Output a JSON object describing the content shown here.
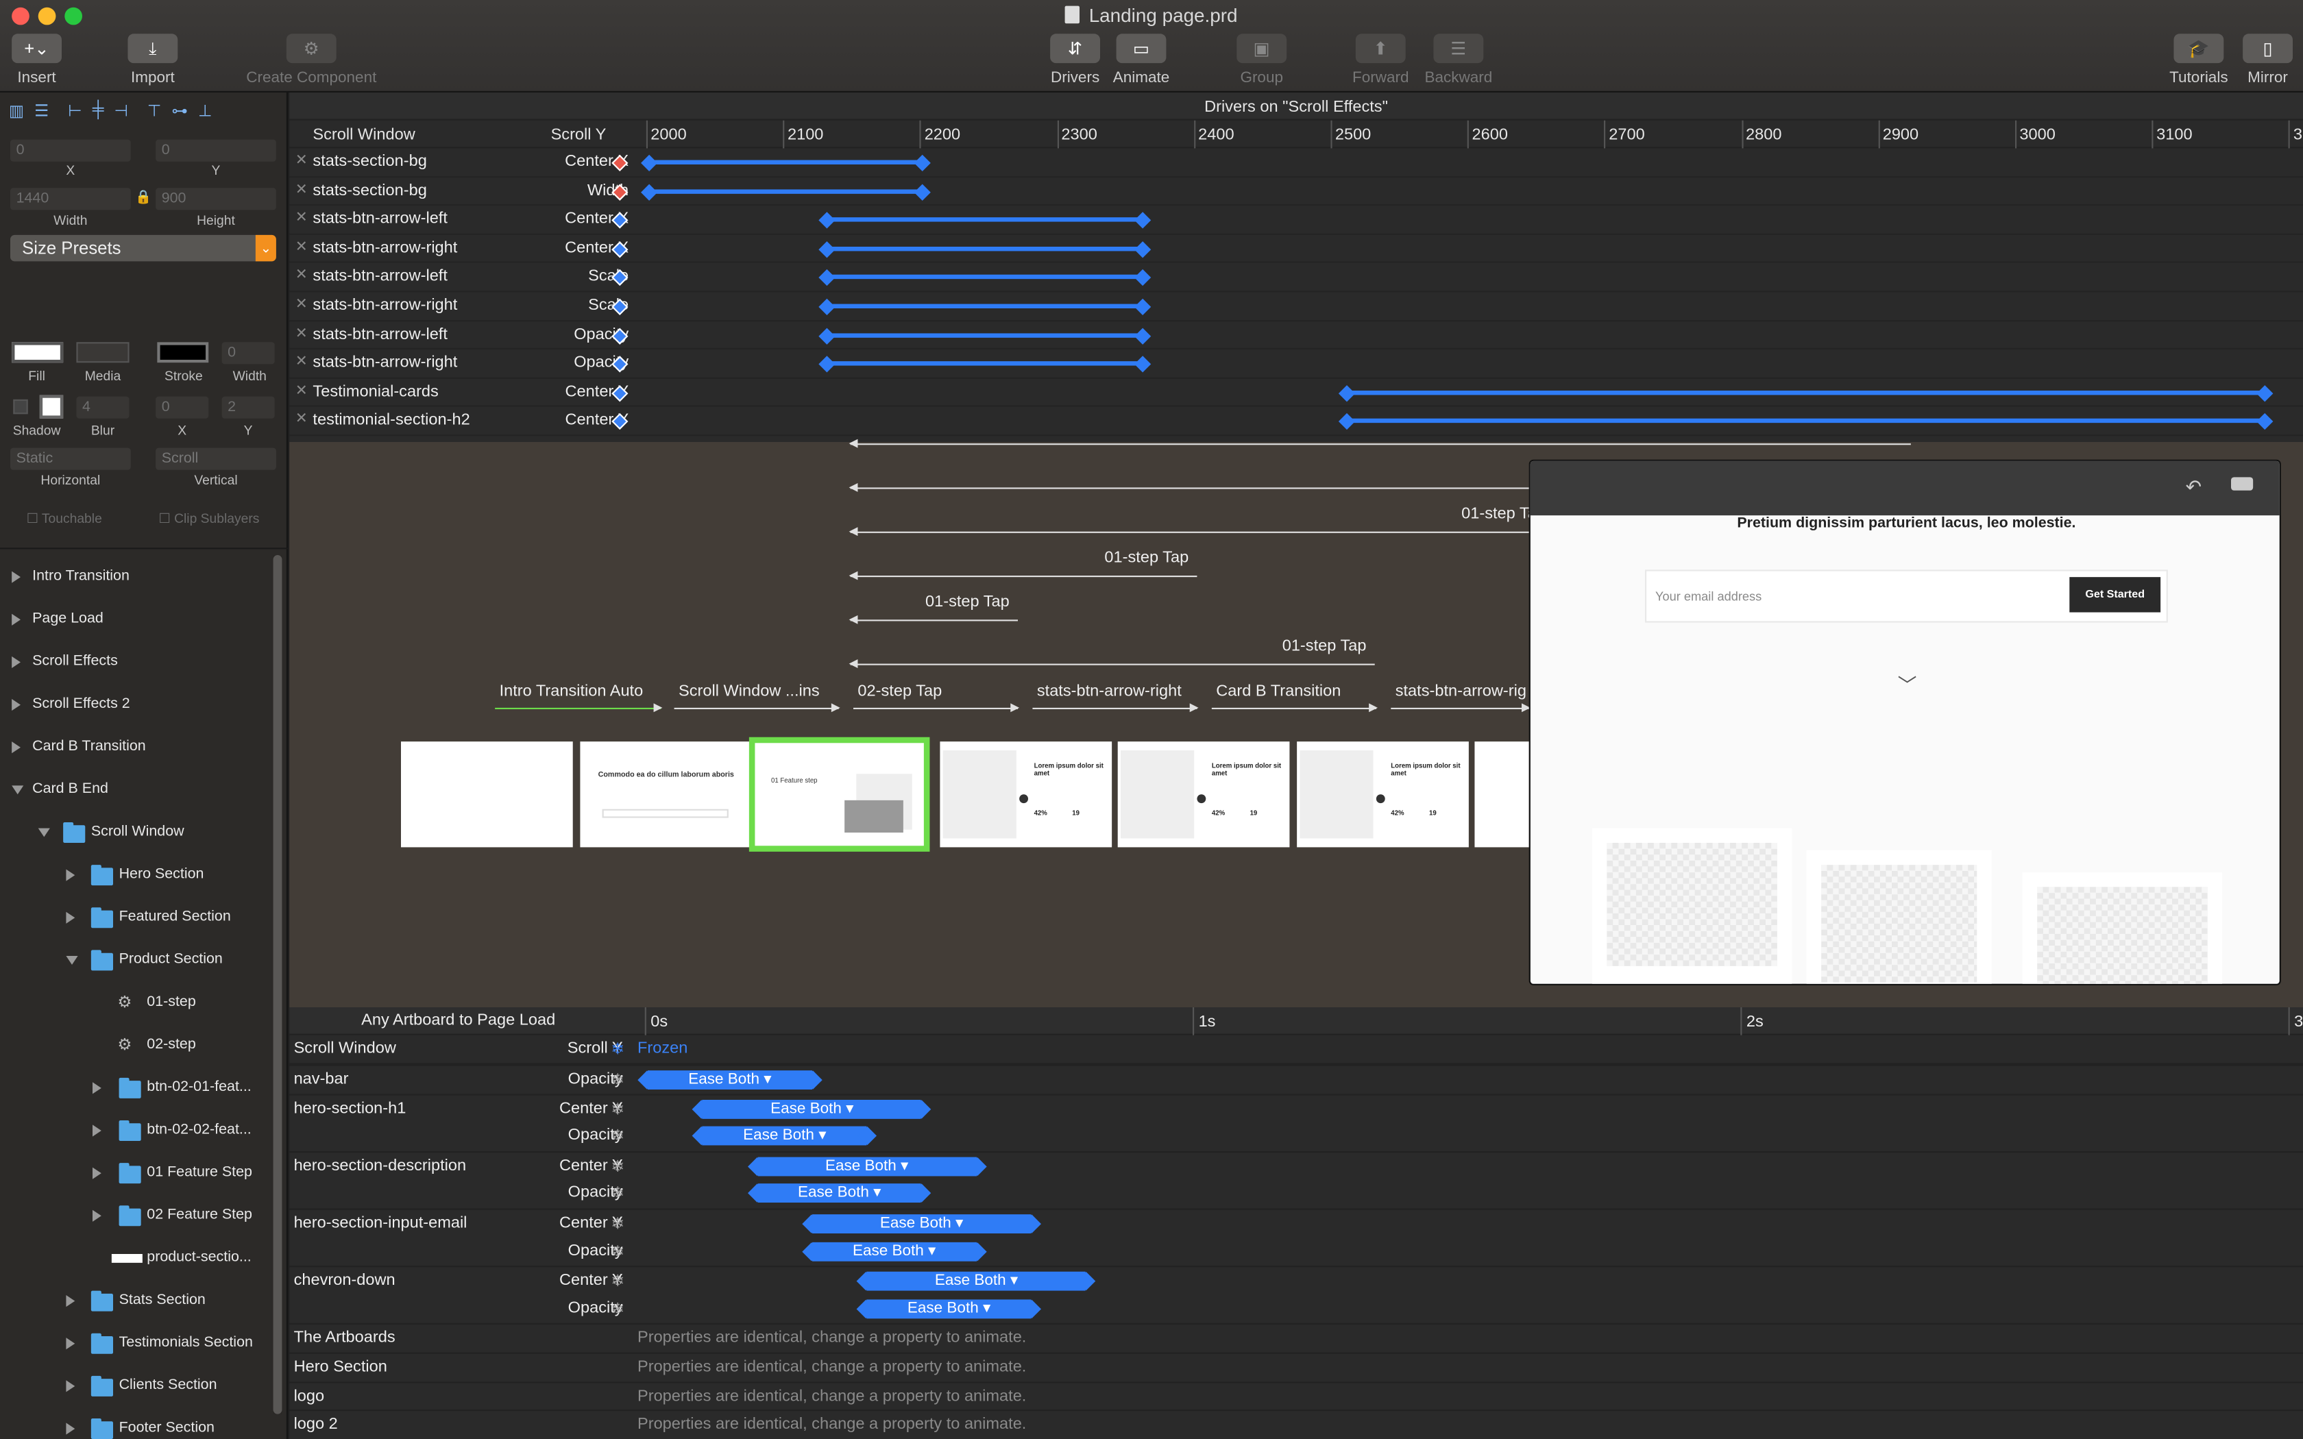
{
  "window": {
    "title": "Landing page.prd"
  },
  "toolbar": {
    "insert": "Insert",
    "import": "Import",
    "create_component": "Create Component",
    "drivers": "Drivers",
    "animate": "Animate",
    "group": "Group",
    "forward": "Forward",
    "backward": "Backward",
    "tutorials": "Tutorials",
    "mirror": "Mirror"
  },
  "inspector": {
    "x_value": "0",
    "y_value": "0",
    "x_label": "X",
    "y_label": "Y",
    "width_value": "1440",
    "height_value": "900",
    "width_label": "Width",
    "height_label": "Height",
    "size_presets": "Size Presets",
    "fill": "Fill",
    "media": "Media",
    "stroke": "Stroke",
    "stroke_width": "0",
    "stroke_width_label": "Width",
    "shadow": "Shadow",
    "blur": "Blur",
    "blur_value": "4",
    "shadow_x": "0",
    "shadow_y": "2",
    "shadow_x_label": "X",
    "shadow_y_label": "Y",
    "horizontal_value": "Static",
    "horizontal_label": "Horizontal",
    "vertical_value": "Scroll",
    "vertical_label": "Vertical",
    "touchable": "Touchable",
    "clip_sublayers": "Clip Sublayers"
  },
  "layers": [
    "Intro Transition",
    "Page Load",
    "Scroll Effects",
    "Scroll Effects 2",
    "Card B Transition",
    "Card B End",
    "Scroll Window",
    "Hero Section",
    "Featured Section",
    "Product Section",
    "01-step",
    "02-step",
    "btn-02-01-feat...",
    "btn-02-02-feat...",
    "01 Feature Step",
    "02 Feature Step",
    "product-sectio...",
    "Stats Section",
    "Testimonials Section",
    "Clients Section",
    "Footer Section"
  ],
  "drivers": {
    "title": "Drivers on \"Scroll Effects\"",
    "col_layer": "Scroll Window",
    "col_prop": "Scroll Y",
    "ticks": [
      "2000",
      "2100",
      "2200",
      "2300",
      "2400",
      "2500",
      "2600",
      "2700",
      "2800",
      "2900",
      "3000",
      "3100",
      "3"
    ],
    "rows": [
      {
        "layer": "stats-section-bg",
        "prop": "Center X"
      },
      {
        "layer": "stats-section-bg",
        "prop": "Width"
      },
      {
        "layer": "stats-btn-arrow-left",
        "prop": "Center X"
      },
      {
        "layer": "stats-btn-arrow-right",
        "prop": "Center X"
      },
      {
        "layer": "stats-btn-arrow-left",
        "prop": "Scale"
      },
      {
        "layer": "stats-btn-arrow-right",
        "prop": "Scale"
      },
      {
        "layer": "stats-btn-arrow-left",
        "prop": "Opacity"
      },
      {
        "layer": "stats-btn-arrow-right",
        "prop": "Opacity"
      },
      {
        "layer": "Testimonial-cards",
        "prop": "Center Y"
      },
      {
        "layer": "testimonial-section-h2",
        "prop": "Center Y"
      }
    ],
    "ranges": [
      [
        2000,
        2200
      ],
      [
        2000,
        2200
      ],
      [
        2130,
        2360
      ],
      [
        2130,
        2360
      ],
      [
        2130,
        2360
      ],
      [
        2130,
        2360
      ],
      [
        2130,
        2360
      ],
      [
        2130,
        2360
      ],
      [
        2510,
        3180
      ],
      [
        2510,
        3180
      ]
    ]
  },
  "canvas": {
    "connections": [
      "01-step Tap",
      "01-step Tap",
      "01-step Tap",
      "01-step Tap",
      "Intro Transition Auto",
      "Scroll Window ...ins",
      "02-step Tap",
      "stats-btn-arrow-right",
      "Card B Transition",
      "stats-btn-arrow-rig"
    ],
    "thumb_text": {
      "t2_title": "Commodo ea do cillum laborum aboris",
      "t3_title": "01 Feature step",
      "t4_title": "Lorem ipsum dolor sit amet",
      "stat_a": "42%",
      "stat_b": "19"
    }
  },
  "preview": {
    "headline": "Pretium dignissim parturient lacus, leo molestie.",
    "email_placeholder": "Your email address",
    "cta": "Get Started"
  },
  "timeline": {
    "title": "Any Artboard to Page Load",
    "ticks": [
      "0s",
      "1s",
      "2s",
      "3"
    ],
    "scroll_layer": "Scroll Window",
    "scroll_prop": "Scroll Y",
    "frozen": "Frozen",
    "ease": "Ease Both",
    "rows": [
      {
        "layer": "nav-bar",
        "prop": "Opacity",
        "start": 0,
        "end": 0.3
      },
      {
        "layer": "hero-section-h1",
        "prop": "Center Y",
        "start": 0.1,
        "end": 0.5
      },
      {
        "layer": "",
        "prop": "Opacity",
        "start": 0.1,
        "end": 0.4
      },
      {
        "layer": "hero-section-description",
        "prop": "Center Y",
        "start": 0.2,
        "end": 0.6
      },
      {
        "layer": "",
        "prop": "Opacity",
        "start": 0.2,
        "end": 0.5
      },
      {
        "layer": "hero-section-input-email",
        "prop": "Center Y",
        "start": 0.3,
        "end": 0.7
      },
      {
        "layer": "",
        "prop": "Opacity",
        "start": 0.3,
        "end": 0.6
      },
      {
        "layer": "chevron-down",
        "prop": "Center Y",
        "start": 0.4,
        "end": 0.8
      },
      {
        "layer": "",
        "prop": "Opacity",
        "start": 0.4,
        "end": 0.7
      }
    ],
    "static_rows": [
      "The Artboards",
      "Hero Section",
      "logo",
      "logo 2"
    ],
    "identical": "Properties are identical, change a property to animate."
  },
  "colors": {
    "accent": "#2f7cf6",
    "selection": "#6ddc4a",
    "presets": "#f3901e"
  }
}
